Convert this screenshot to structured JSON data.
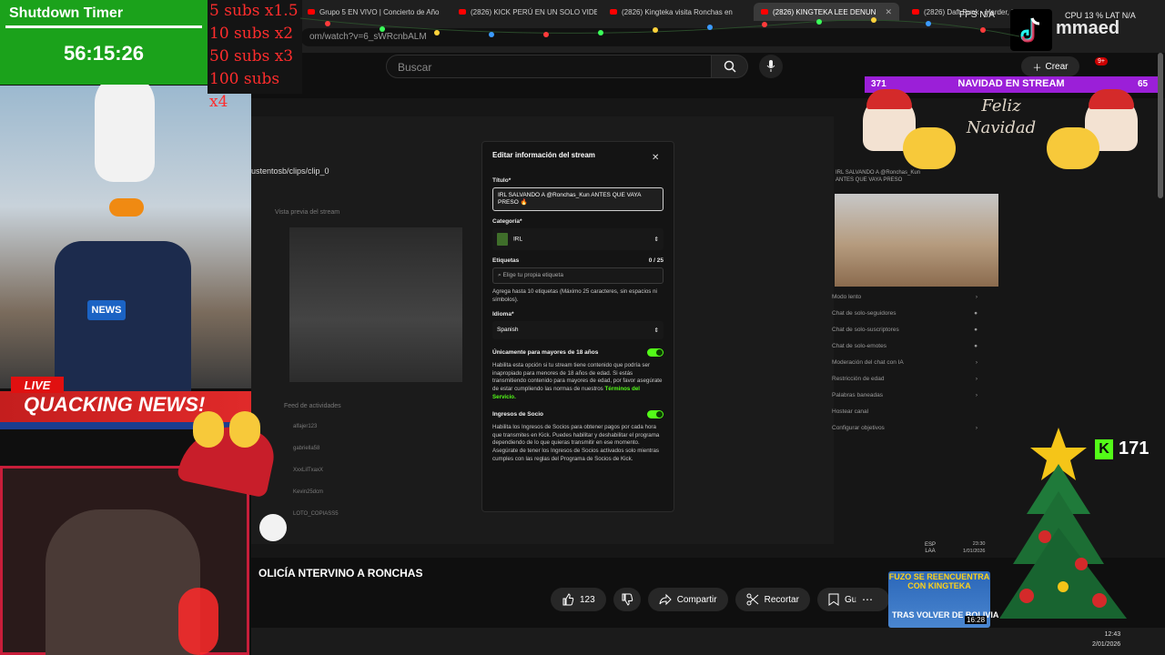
{
  "browser": {
    "tabs": [
      {
        "label": "Grupo 5 EN VIVO | Concierto de Año"
      },
      {
        "label": "(2826) KICK PERÚ EN UN SOLO VIDE"
      },
      {
        "label": "(2826) Kingteka visita Ronchas en"
      },
      {
        "label": "(2826) KINGTEKA LEE DENUN",
        "active": true
      },
      {
        "label": "(2826) Daft Punk - Harder, Bett"
      }
    ],
    "url": "om/watch?v=6_sWRcnbALM"
  },
  "youtube": {
    "search_placeholder": "Buscar",
    "create_label": "Crear",
    "notif_count": "9+",
    "video_title": "OLICÍA NTERVINO A RONCHAS",
    "likes": "123",
    "actions": {
      "share": "Compartir",
      "clip": "Recortar",
      "save": "Guardar"
    },
    "thumbnail": {
      "top_text": "FUZO SE REENCUENTRA CON KINGTEKA",
      "bottom_text": "TRAS VOLVER DE BOLIVIA",
      "duration": "16:28"
    }
  },
  "stream_overlay": {
    "timer_title": "Shutdown Timer",
    "timer_value": "56:15:26",
    "subs_multipliers": [
      "5 subs x1.5",
      "10 subs x2",
      "50 subs x3",
      "100 subs x4"
    ],
    "live_label": "LIVE",
    "news_banner": "QUACKING NEWS!",
    "mic_label": "NEWS",
    "fps_label": "FPS N/A",
    "cpu_label": "CPU 13 %  LAT N/A",
    "tiktok_name": "mmaed",
    "navidad_label": "NAVIDAD EN STREAM",
    "navidad_left": "371",
    "navidad_right": "65",
    "feliz_line1": "Feliz",
    "feliz_line2": "Navidad",
    "kick_followers": "171"
  },
  "kick_dashboard": {
    "clip_path": "ustentosb/clips/clip_0",
    "preview_label": "Vista previa del stream",
    "feed_label": "Feed de actividades",
    "feed_users": [
      "alfajer123",
      "gabriella58",
      "XxxLilTxaxX",
      "Kevin25dcm",
      "LOTO_COPIASS5"
    ],
    "info_panel_items": [
      "Modo lento",
      "Chat de solo-seguidores",
      "Chat de solo-suscriptores",
      "Chat de solo-emotes",
      "Moderación del chat con IA",
      "Restricción de edad",
      "Palabras baneadas",
      "Hostear canal",
      "Configurar objetivos"
    ],
    "info_title_text": "IRL SALVANDO A @Ronchas_Kun ANTES QUE VAYA PRESO"
  },
  "modal": {
    "title": "Editar información del stream",
    "titulo_label": "Título*",
    "titulo_value": "IRL SALVANDO A @Ronchas_Kun ANTES QUE VAYA PRESO 🔥",
    "categoria_label": "Categoría*",
    "categoria_value": "IRL",
    "etiquetas_label": "Etiquetas",
    "etiquetas_count": "0 / 25",
    "etiquetas_placeholder": "Elige tu propia etiqueta",
    "etiquetas_help": "Agrega hasta 10 etiquetas (Máximo 25 caracteres, sin espacios ni símbolos).",
    "idioma_label": "Idioma*",
    "idioma_value": "Spanish",
    "mayores_label": "Únicamente para mayores de 18 años",
    "mayores_text": "Habilita esta opción si tu stream tiene contenido que podría ser inapropiado para menores de 18 años de edad. Si estás transmitiendo contenido para mayores de edad, por favor asegúrate de estar cumpliendo las normas de nuestros",
    "terminos_link": "Términos del Servicio.",
    "socio_label": "Ingresos de Socio",
    "socio_text": "Habilita los Ingresos de Socios para obtener pagos por cada hora que transmites en Kick. Puedes habilitar y deshabilitar el programa dependiendo de lo que quieras transmitir en ese momento. Asegúrate de tener los Ingresos de Socios activados solo mientras cumples con las reglas del Programa de Socios de Kick."
  },
  "taskbar": {
    "lang_top": "ESP",
    "lang_bottom": "LAA",
    "time": "12:43",
    "date": "2/01/2026",
    "inner_time": "23:30",
    "inner_date": "1/01/2026"
  },
  "colors": {
    "kick_green": "#53fc18",
    "timer_green": "#1ba21b",
    "news_red": "#e01010",
    "navidad_purple": "#9b1fd8"
  }
}
